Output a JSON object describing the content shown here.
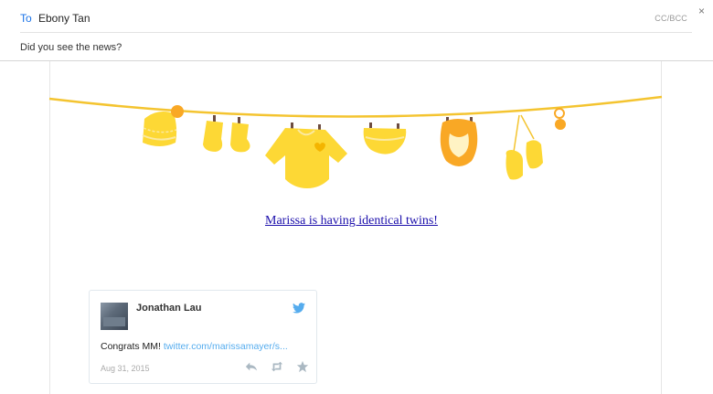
{
  "compose": {
    "to_label": "To",
    "recipient": "Ebony Tan",
    "ccbcc": "CC/BCC",
    "close_icon": "×",
    "subject": "Did you see the news?"
  },
  "email": {
    "link_text": "Marissa is having identical twins!"
  },
  "tweet": {
    "author": "Jonathan Lau",
    "text": "Congrats MM! ",
    "link": "twitter.com/marissamayer/s...",
    "date": "Aug 31, 2015",
    "icons": [
      "twitter-bird-icon",
      "reply-icon",
      "retweet-icon",
      "favorite-icon"
    ]
  },
  "colors": {
    "accent": "#1a73e8",
    "baby_yellow": "#fdd835",
    "twitter_blue": "#55acee"
  }
}
